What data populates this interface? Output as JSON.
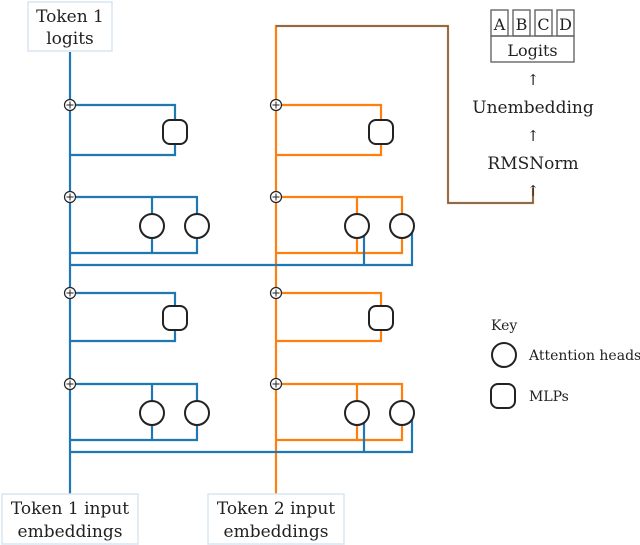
{
  "colors": {
    "token1": "#1f77b4",
    "token2": "#ff7f0e",
    "output_path": "#666666",
    "node_stroke": "#222222"
  },
  "labels": {
    "token1_logits_line1": "Token 1",
    "token1_logits_line2": "logits",
    "token1_input_line1": "Token 1 input",
    "token1_input_line2": "embeddings",
    "token2_input_line1": "Token 2 input",
    "token2_input_line2": "embeddings"
  },
  "output_stack": {
    "answer_options": [
      "A",
      "B",
      "C",
      "D"
    ],
    "logits_label": "Logits",
    "unembedding_label": "Unembedding",
    "rmsnorm_label": "RMSNorm",
    "arrow_glyph": "↑"
  },
  "key": {
    "title": "Key",
    "items": [
      {
        "shape": "circle",
        "label": "Attention heads"
      },
      {
        "shape": "rounded-square",
        "label": "MLPs"
      }
    ]
  },
  "layers": [
    {
      "type": "mlp",
      "position": 1
    },
    {
      "type": "attention",
      "heads": 2,
      "position": 2
    },
    {
      "type": "mlp",
      "position": 3
    },
    {
      "type": "attention",
      "heads": 2,
      "position": 4
    }
  ],
  "plus_glyph": "+"
}
